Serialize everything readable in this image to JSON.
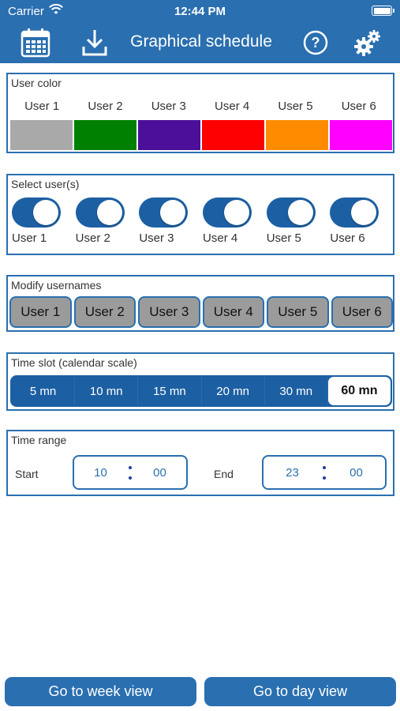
{
  "status_bar": {
    "carrier": "Carrier",
    "time": "12:44 PM"
  },
  "nav": {
    "title": "Graphical schedule",
    "icons": [
      "calendar-icon",
      "download-icon",
      "help-icon",
      "settings-gears-icon"
    ]
  },
  "user_color": {
    "title": "User color",
    "users": [
      {
        "label": "User 1",
        "color": "#a9a9a9"
      },
      {
        "label": "User 2",
        "color": "#008000"
      },
      {
        "label": "User 3",
        "color": "#4b0f9a"
      },
      {
        "label": "User 4",
        "color": "#ff0000"
      },
      {
        "label": "User 5",
        "color": "#ff8c00"
      },
      {
        "label": "User 6",
        "color": "#ff00ff"
      }
    ]
  },
  "select_users": {
    "title": "Select user(s)",
    "users": [
      {
        "label": "User 1",
        "on": true
      },
      {
        "label": "User 2",
        "on": true
      },
      {
        "label": "User 3",
        "on": true
      },
      {
        "label": "User 4",
        "on": true
      },
      {
        "label": "User 5",
        "on": true
      },
      {
        "label": "User 6",
        "on": true
      }
    ]
  },
  "modify_usernames": {
    "title": "Modify usernames",
    "names": [
      "User 1",
      "User 2",
      "User 3",
      "User 4",
      "User 5",
      "User 6"
    ]
  },
  "time_slot": {
    "title": "Time slot (calendar scale)",
    "options": [
      "5 mn",
      "10 mn",
      "15 mn",
      "20 mn",
      "30 mn",
      "60 mn"
    ],
    "selected": "60 mn"
  },
  "time_range": {
    "title": "Time range",
    "start_label": "Start",
    "start_hour": "10",
    "start_min": "00",
    "end_label": "End",
    "end_hour": "23",
    "end_min": "00"
  },
  "footer": {
    "week_button": "Go to week view",
    "day_button": "Go to day view"
  },
  "colors": {
    "bar": "#2a6fb0",
    "accent": "#1c5fa3"
  }
}
